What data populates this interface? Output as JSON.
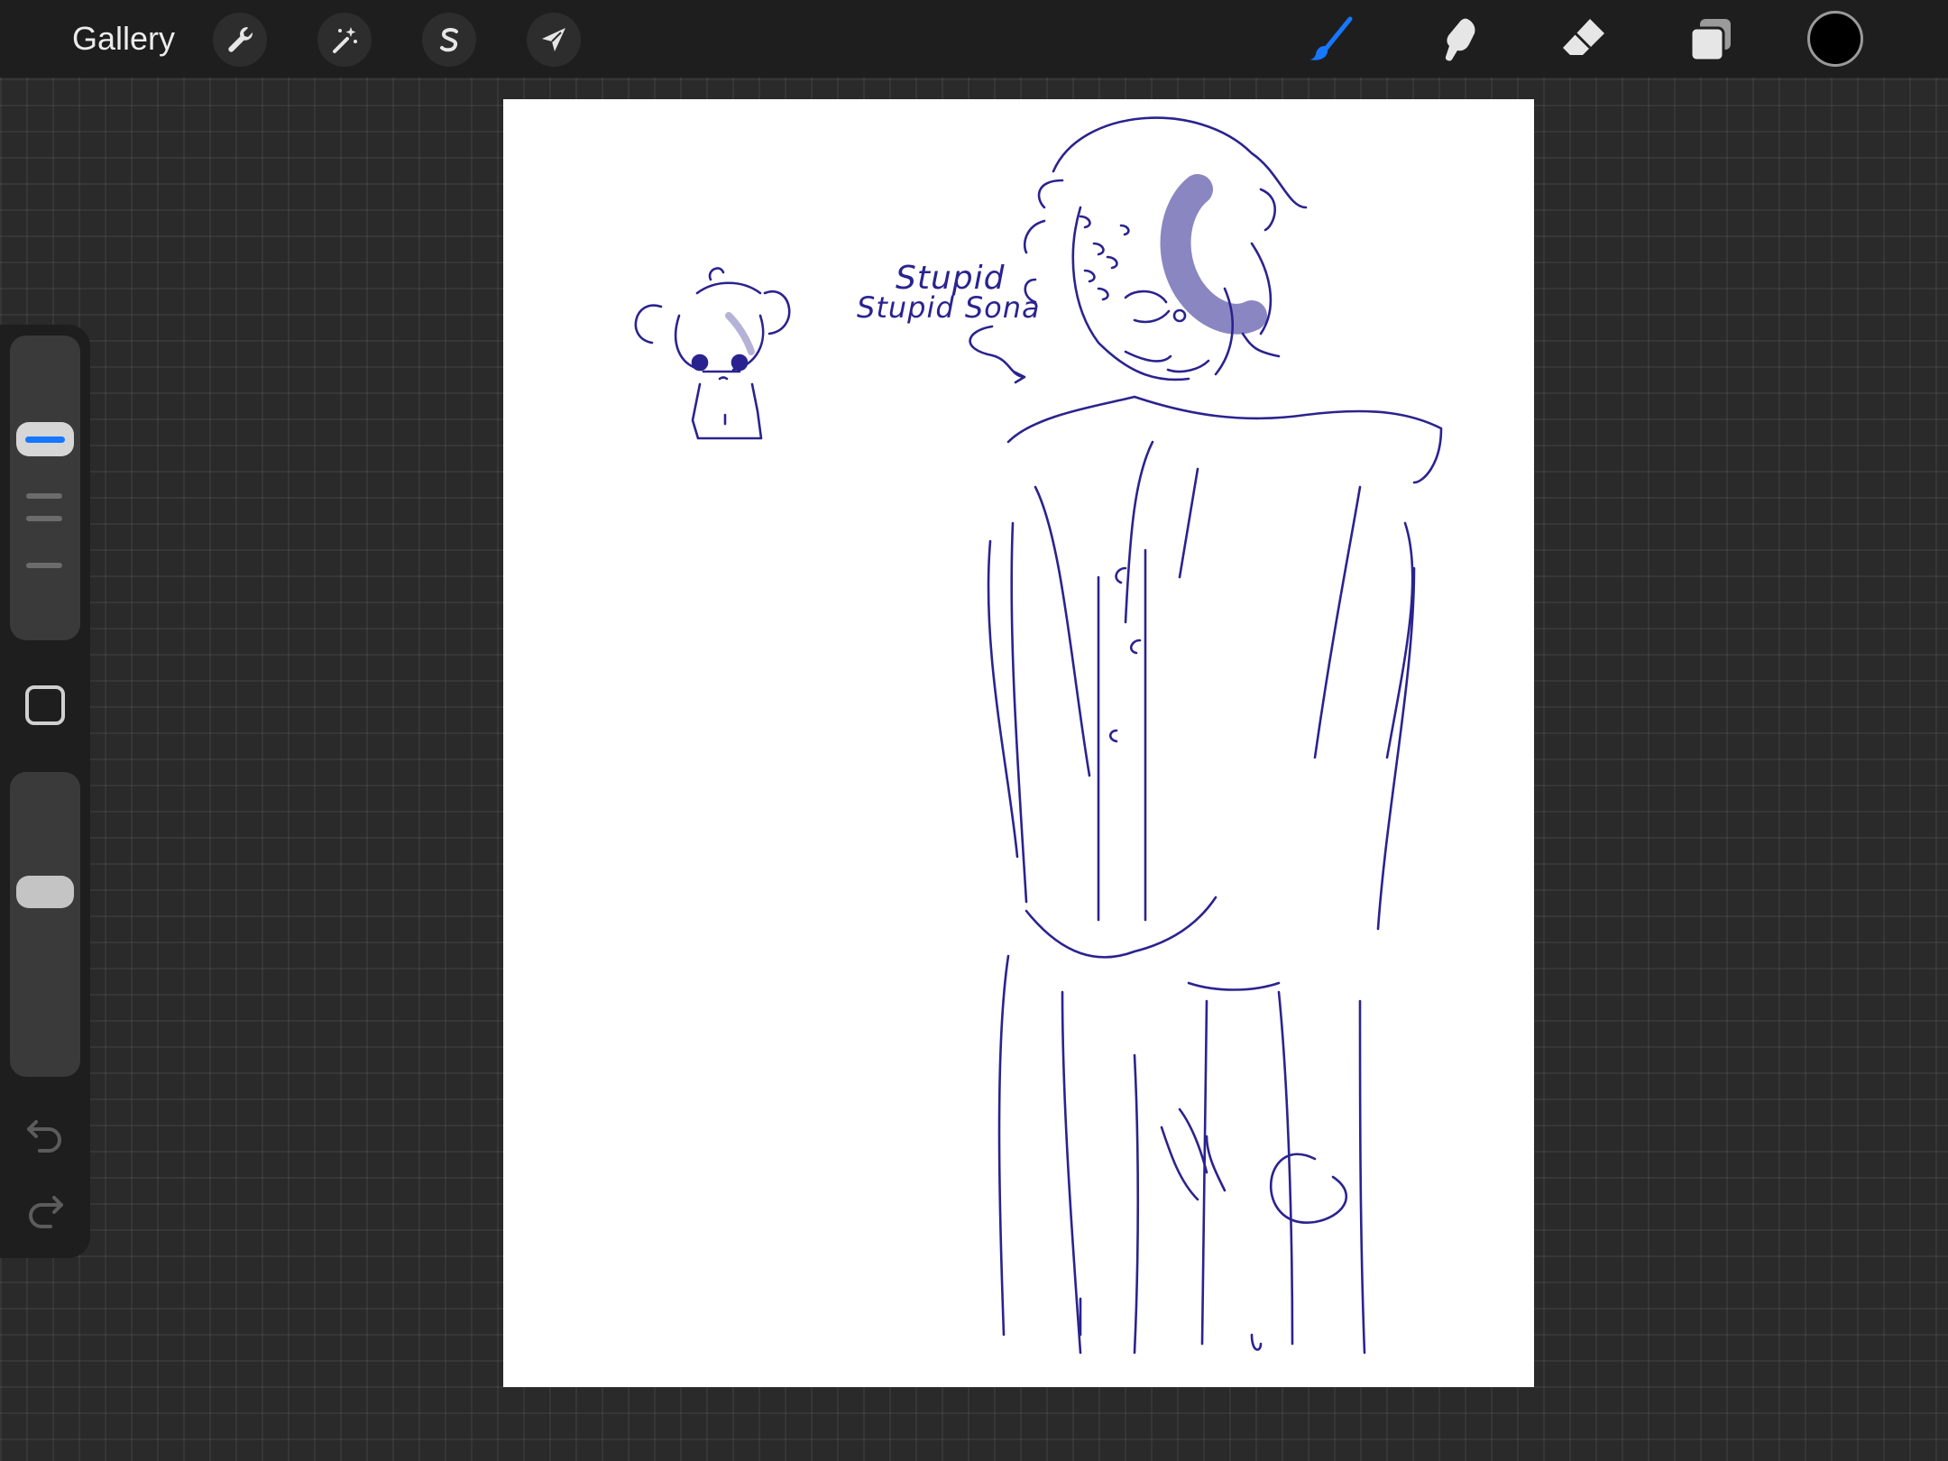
{
  "toolbar": {
    "gallery_label": "Gallery",
    "left_tools": [
      {
        "name": "actions",
        "icon": "wrench-icon"
      },
      {
        "name": "adjustments",
        "icon": "magic-wand-icon"
      },
      {
        "name": "selection",
        "icon": "selection-s-icon"
      },
      {
        "name": "transform",
        "icon": "arrow-cursor-icon"
      }
    ],
    "right_tools": [
      {
        "name": "brush",
        "icon": "brush-icon",
        "active": true
      },
      {
        "name": "smudge",
        "icon": "smudge-finger-icon",
        "active": false
      },
      {
        "name": "eraser",
        "icon": "eraser-icon",
        "active": false
      },
      {
        "name": "layers",
        "icon": "layers-icon",
        "active": false
      }
    ],
    "current_color": "#000000",
    "active_color": "#1677ff"
  },
  "sidebar": {
    "brush_size_level": 0.68,
    "opacity_level": 0.62,
    "modify_icon": "square-modify-icon",
    "undo_icon": "undo-icon",
    "redo_icon": "redo-icon"
  },
  "canvas": {
    "background": "#ffffff",
    "ink_color": "#2a238f",
    "note_line1": "Stupid",
    "note_line2": "Stupid Sona"
  }
}
